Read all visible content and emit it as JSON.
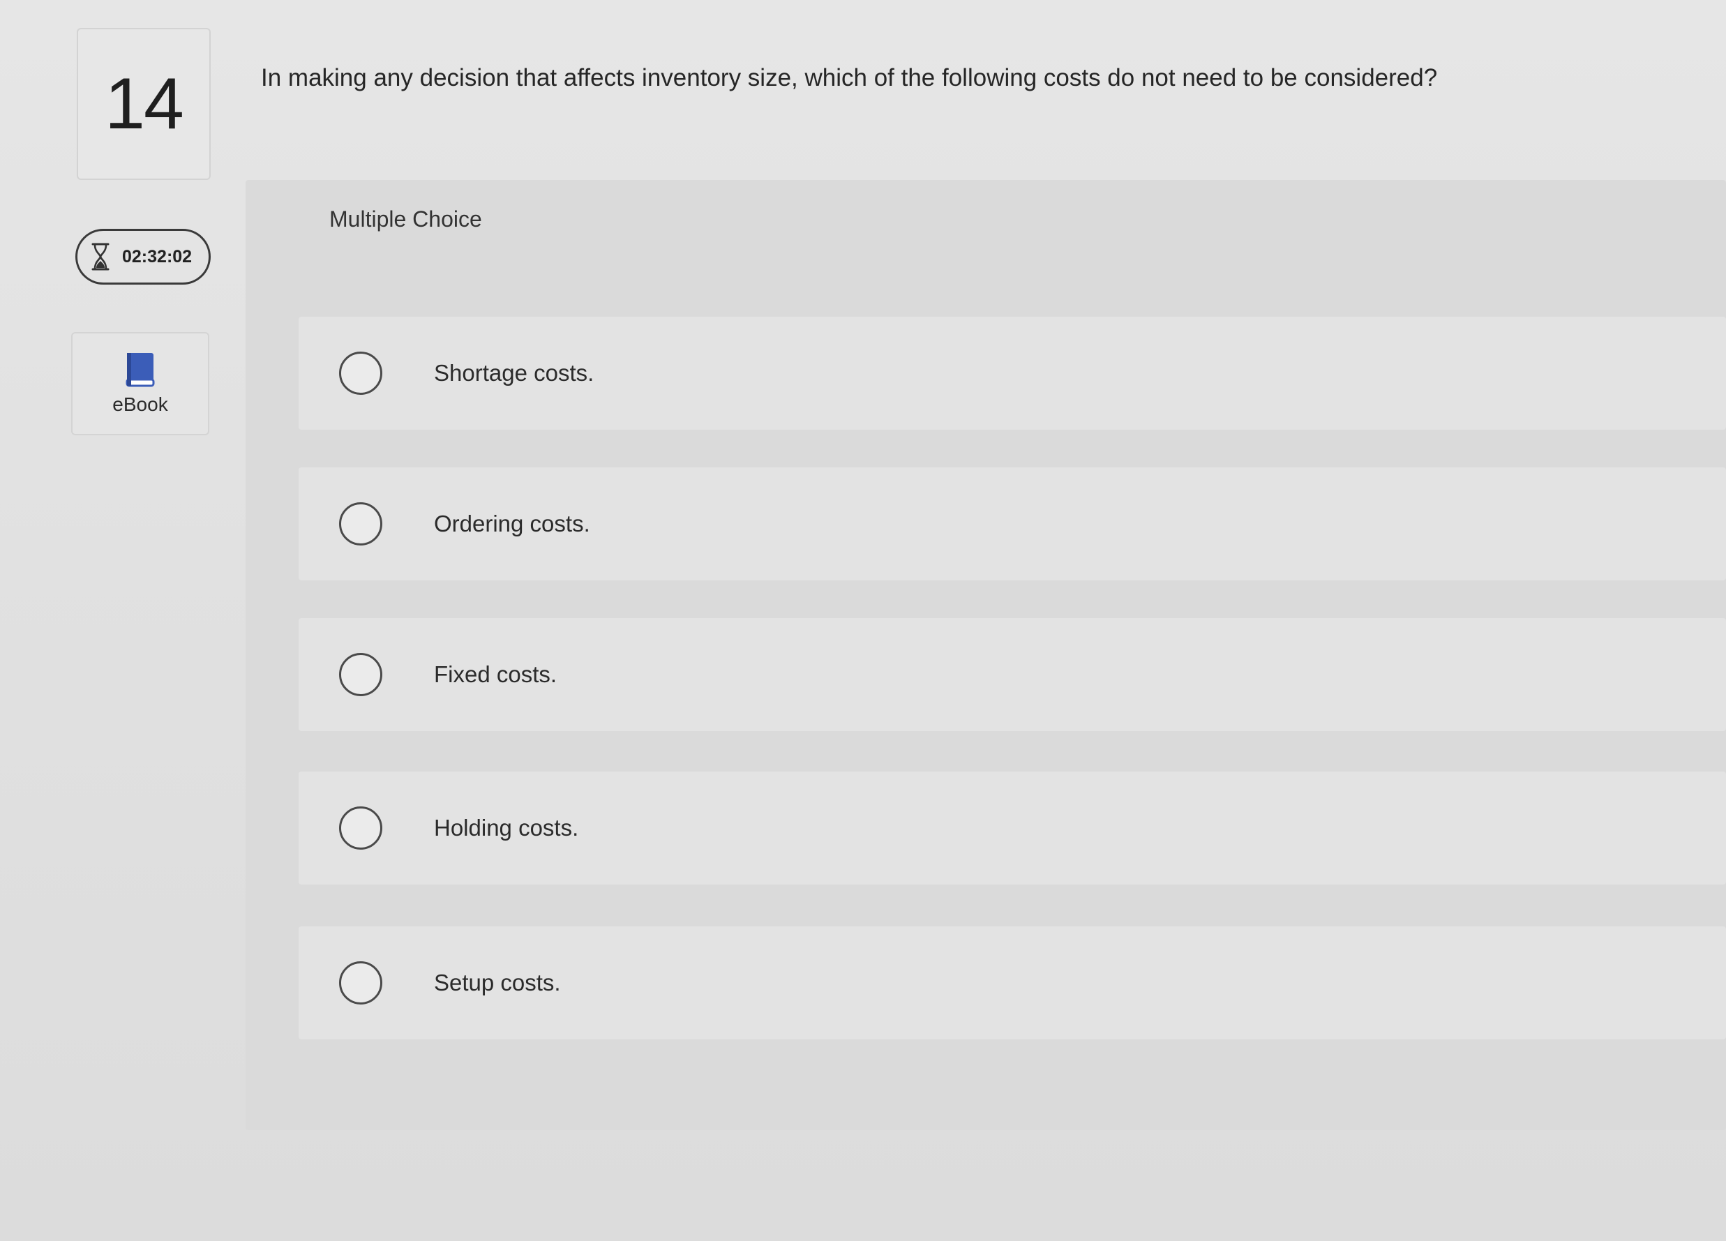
{
  "question": {
    "number": "14",
    "text": "In making any decision that affects inventory size, which of the following costs do not need to be considered?"
  },
  "timer": {
    "icon": "hourglass-icon",
    "time": "02:32:02"
  },
  "ebook": {
    "icon": "book-icon",
    "label": "eBook",
    "icon_color": "#3b5db8"
  },
  "answer_section": {
    "type_label": "Multiple Choice",
    "choices": [
      {
        "label": "Shortage costs.",
        "selected": false
      },
      {
        "label": "Ordering costs.",
        "selected": false
      },
      {
        "label": "Fixed costs.",
        "selected": false
      },
      {
        "label": "Holding costs.",
        "selected": false
      },
      {
        "label": "Setup costs.",
        "selected": false
      }
    ]
  }
}
